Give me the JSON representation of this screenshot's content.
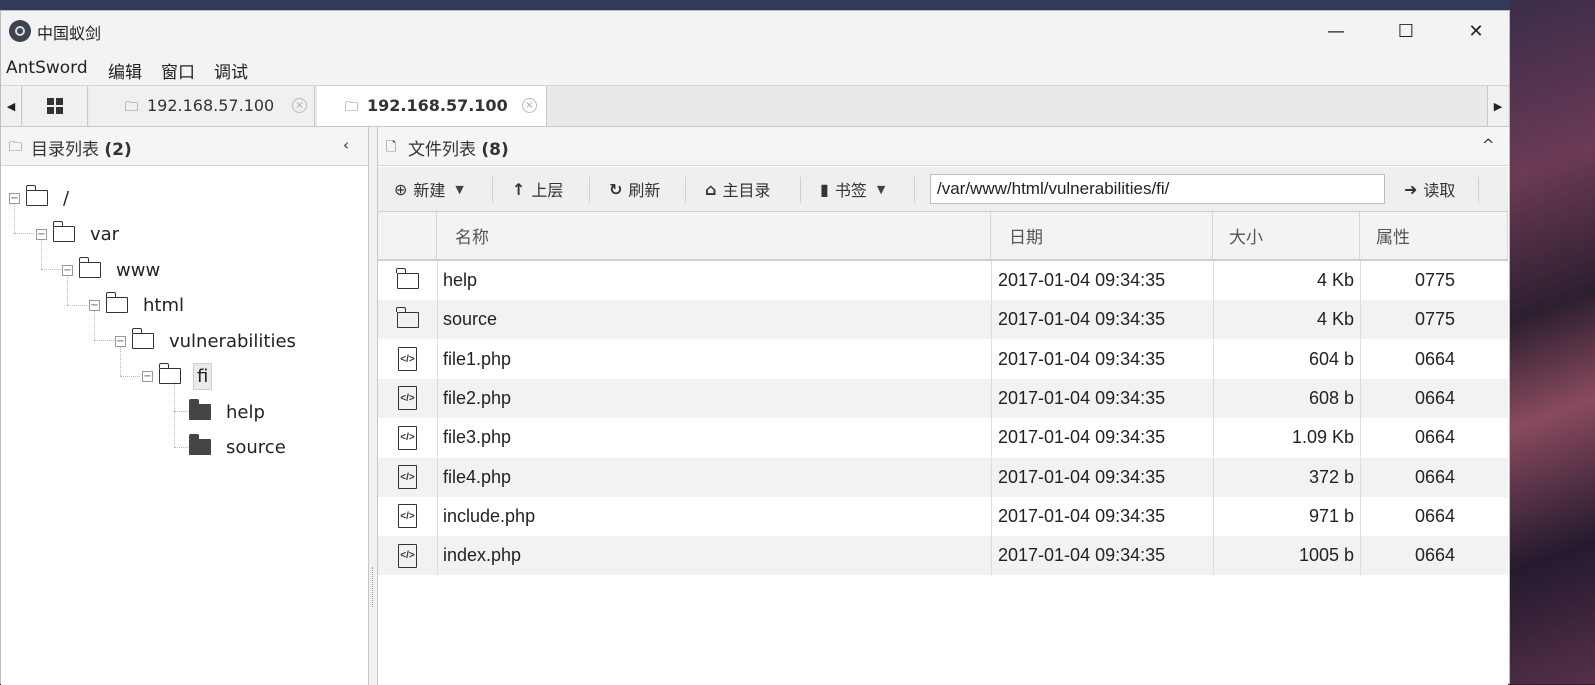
{
  "window": {
    "title": "中国蚁剑",
    "minimize_glyph": "—",
    "maximize_glyph": "☐",
    "close_glyph": "✕"
  },
  "menubar": {
    "items": [
      "AntSword",
      "编辑",
      "窗口",
      "调试"
    ]
  },
  "tabs": {
    "left_arrow": "◀",
    "right_arrow": "▶",
    "items": [
      {
        "label": "192.168.57.100",
        "active": false
      },
      {
        "label": "192.168.57.100",
        "active": true
      }
    ],
    "close_glyph": "×"
  },
  "dir_panel": {
    "title": "目录列表",
    "count": "(2)",
    "collapse_glyph": "‹"
  },
  "tree": {
    "toggle_glyph": "−",
    "nodes": [
      {
        "label": "/",
        "open": true,
        "selected": false,
        "filled": false
      },
      {
        "label": "var",
        "open": true,
        "selected": false,
        "filled": false
      },
      {
        "label": "www",
        "open": true,
        "selected": false,
        "filled": false
      },
      {
        "label": "html",
        "open": true,
        "selected": false,
        "filled": false
      },
      {
        "label": "vulnerabilities",
        "open": true,
        "selected": false,
        "filled": false
      },
      {
        "label": "fi",
        "open": true,
        "selected": true,
        "filled": false
      },
      {
        "label": "help",
        "open": false,
        "selected": false,
        "filled": true
      },
      {
        "label": "source",
        "open": false,
        "selected": false,
        "filled": true
      }
    ]
  },
  "file_panel": {
    "title": "文件列表",
    "count": "(8)",
    "collapse_glyph": "^"
  },
  "toolbar": {
    "new_icon": "⊕",
    "new_label": "新建",
    "up_icon": "↑",
    "up_label": "上层",
    "refresh_icon": "↻",
    "refresh_label": "刷新",
    "home_icon": "⌂",
    "home_label": "主目录",
    "bookmark_icon": "▮",
    "bookmark_label": "书签",
    "caret": "▼",
    "path": "/var/www/html/vulnerabilities/fi/",
    "read_icon": "➜",
    "read_label": "读取"
  },
  "grid": {
    "columns": [
      "名称",
      "日期",
      "大小",
      "属性"
    ],
    "code_glyph": "</>",
    "rows": [
      {
        "type": "folder",
        "name": "help",
        "date": "2017-01-04 09:34:35",
        "size": "4 Kb",
        "attr": "0775"
      },
      {
        "type": "folder",
        "name": "source",
        "date": "2017-01-04 09:34:35",
        "size": "4 Kb",
        "attr": "0775"
      },
      {
        "type": "code",
        "name": "file1.php",
        "date": "2017-01-04 09:34:35",
        "size": "604 b",
        "attr": "0664"
      },
      {
        "type": "code",
        "name": "file2.php",
        "date": "2017-01-04 09:34:35",
        "size": "608 b",
        "attr": "0664"
      },
      {
        "type": "code",
        "name": "file3.php",
        "date": "2017-01-04 09:34:35",
        "size": "1.09 Kb",
        "attr": "0664"
      },
      {
        "type": "code",
        "name": "file4.php",
        "date": "2017-01-04 09:34:35",
        "size": "372 b",
        "attr": "0664"
      },
      {
        "type": "code",
        "name": "include.php",
        "date": "2017-01-04 09:34:35",
        "size": "971 b",
        "attr": "0664"
      },
      {
        "type": "code",
        "name": "index.php",
        "date": "2017-01-04 09:34:35",
        "size": "1005 b",
        "attr": "0664"
      }
    ]
  }
}
